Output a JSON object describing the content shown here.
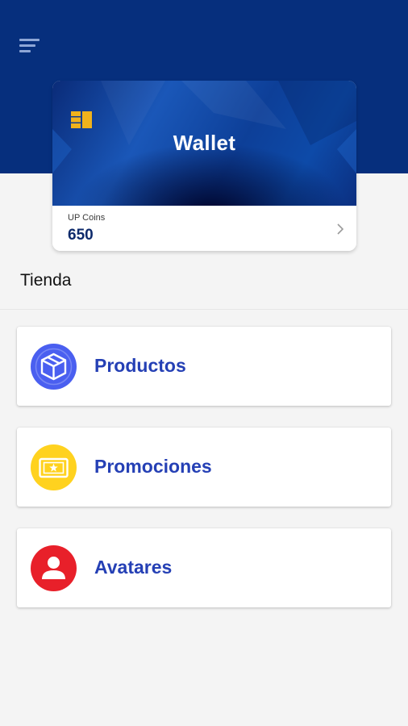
{
  "header": {
    "background_color": "#062f7d",
    "menu_icon": "hamburger-menu-icon"
  },
  "wallet": {
    "title": "Wallet",
    "chip_icon": "card-chip-icon",
    "coins_label": "UP Coins",
    "coins_value": "650",
    "chevron_icon": "chevron-right-icon"
  },
  "store": {
    "title": "Tienda",
    "items": [
      {
        "label": "Productos",
        "icon": "box-icon",
        "icon_color": "#4a5ff0"
      },
      {
        "label": "Promociones",
        "icon": "ticket-star-icon",
        "icon_color": "#ffd21f"
      },
      {
        "label": "Avatares",
        "icon": "user-icon",
        "icon_color": "#e8202a"
      }
    ]
  },
  "colors": {
    "accent_text": "#2540b5",
    "coins_text": "#0d2a6b"
  }
}
